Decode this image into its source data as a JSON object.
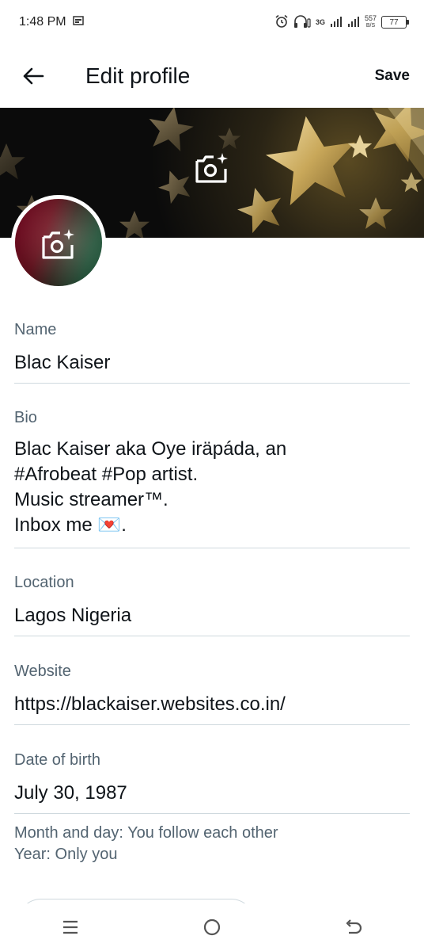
{
  "status_bar": {
    "time": "1:48 PM",
    "net_type": "3G",
    "speed_value": "557",
    "speed_unit": "B/S",
    "battery": "77"
  },
  "header": {
    "title": "Edit profile",
    "save_label": "Save"
  },
  "fields": {
    "name": {
      "label": "Name",
      "value": "Blac Kaiser"
    },
    "bio": {
      "label": "Bio",
      "lines": [
        "Blac Kaiser aka Oye iräpáda, an",
        "#Afrobeat #Pop artist.",
        "Music streamer™.",
        "Inbox me 💌."
      ]
    },
    "location": {
      "label": "Location",
      "value": "Lagos Nigeria"
    },
    "website": {
      "label": "Website",
      "value": "https://blackaiser.websites.co.in/"
    },
    "birth": {
      "label": "Date of birth",
      "value": "July 30, 1987"
    }
  },
  "hint": {
    "line1": "Month and day: You follow each other",
    "line2": "Year: Only you"
  },
  "icons": {
    "back": "arrow-left-icon",
    "banner_camera": "camera-plus-icon",
    "avatar_camera": "camera-plus-icon",
    "nav_menu": "menu-icon",
    "nav_home": "home-circle-icon",
    "nav_back": "back-arrow-icon"
  },
  "colors": {
    "text_primary": "#0f1419",
    "text_secondary": "#536471",
    "divider": "#cfd9de"
  }
}
